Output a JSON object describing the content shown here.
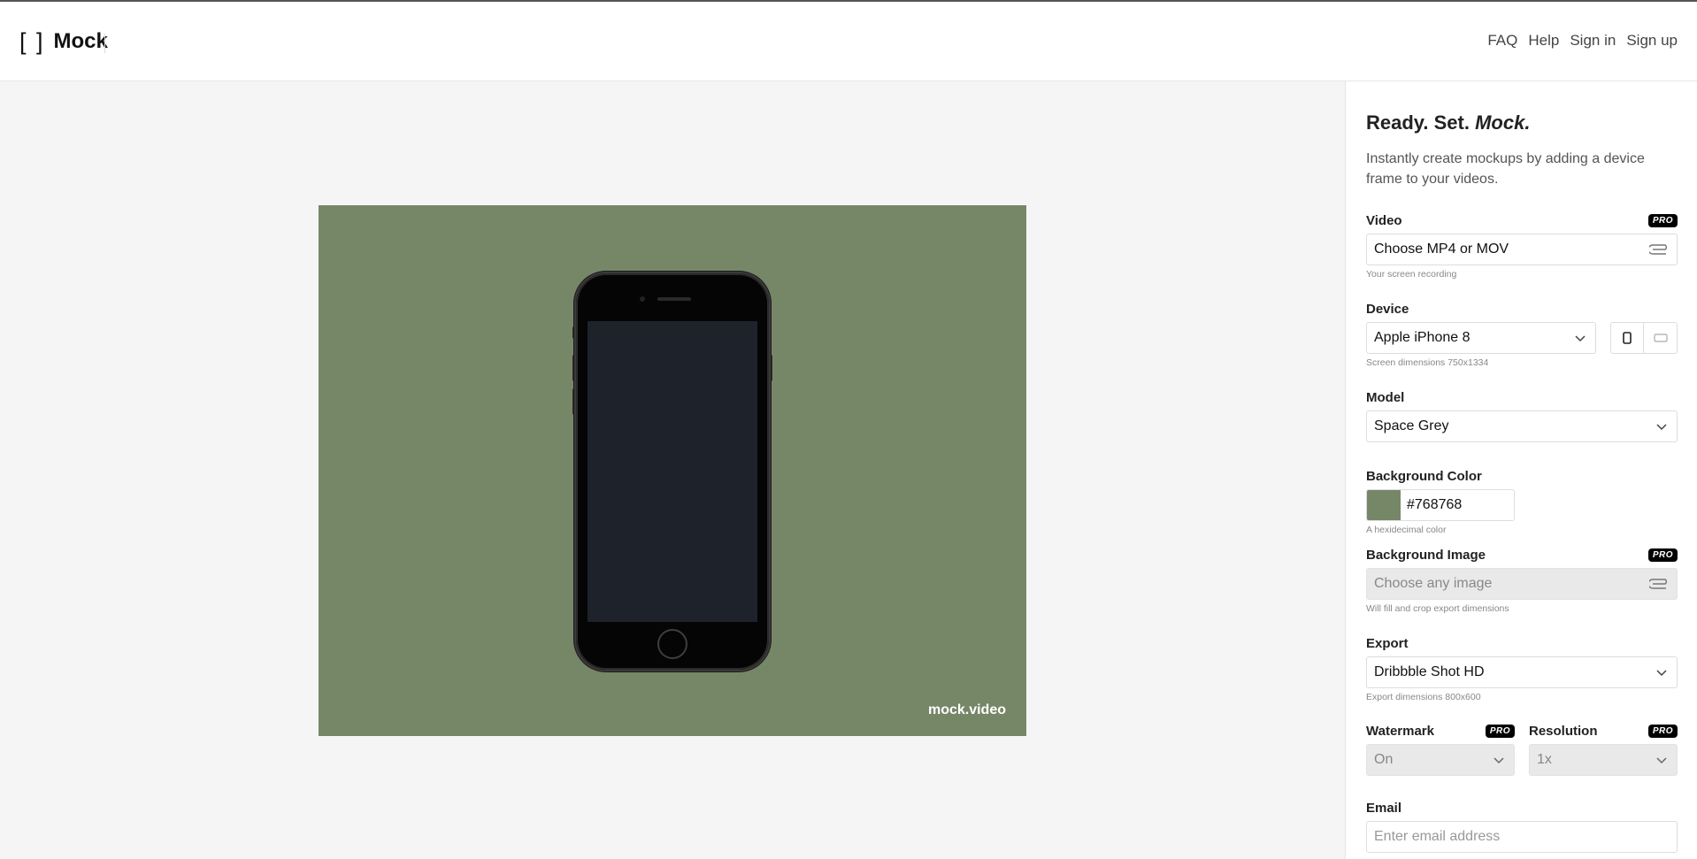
{
  "header": {
    "logo_mark": "[ ]",
    "logo_text": "Mock",
    "nav": [
      "FAQ",
      "Help",
      "Sign in",
      "Sign up"
    ]
  },
  "canvas": {
    "background_color": "#768768",
    "watermark": "mock.video"
  },
  "panel": {
    "title_plain": "Ready. Set.",
    "title_em": "Mock.",
    "intro": "Instantly create mockups by adding a device frame to your videos.",
    "pro_badge": "PRO",
    "video": {
      "label": "Video",
      "placeholder": "Choose MP4 or MOV",
      "hint": "Your screen recording"
    },
    "device": {
      "label": "Device",
      "value": "Apple iPhone 8",
      "hint": "Screen dimensions 750x1334"
    },
    "model": {
      "label": "Model",
      "value": "Space Grey"
    },
    "background_color": {
      "label": "Background Color",
      "value": "#768768",
      "hint": "A hexidecimal color"
    },
    "background_image": {
      "label": "Background Image",
      "placeholder": "Choose any image",
      "hint": "Will fill and crop export dimensions"
    },
    "export": {
      "label": "Export",
      "value": "Dribbble Shot HD",
      "hint": "Export dimensions 800x600"
    },
    "watermark": {
      "label": "Watermark",
      "value": "On"
    },
    "resolution": {
      "label": "Resolution",
      "value": "1x"
    },
    "email": {
      "label": "Email",
      "placeholder": "Enter email address"
    }
  }
}
